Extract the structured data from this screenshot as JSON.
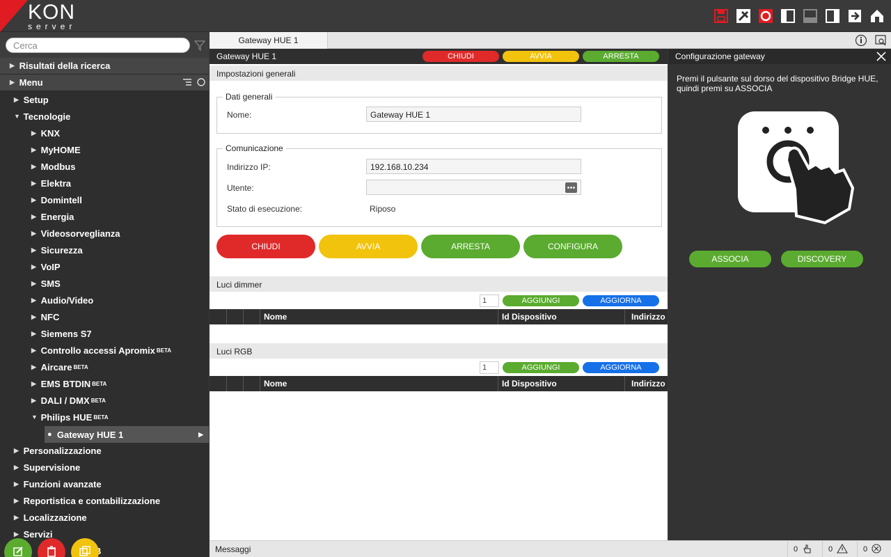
{
  "header": {
    "logo_text": "KON",
    "logo_sub": "server",
    "toolbar_icons": [
      "save-icon",
      "pin-icon",
      "sync-icon",
      "panel-left-icon",
      "panel-bottom-icon",
      "panel-right-icon",
      "exit-icon",
      "home-icon"
    ]
  },
  "sidebar": {
    "search_placeholder": "Cerca",
    "results_label": "Risultati della ricerca",
    "menu_label": "Menu",
    "items": {
      "setup": "Setup",
      "tecnologie": "Tecnologie",
      "knx": "KNX",
      "myhome": "MyHOME",
      "modbus": "Modbus",
      "elektra": "Elektra",
      "domintell": "Domintell",
      "energia": "Energia",
      "video": "Videosorveglianza",
      "sicurezza": "Sicurezza",
      "voip": "VoIP",
      "sms": "SMS",
      "audio": "Audio/Video",
      "nfc": "NFC",
      "siemens": "Siemens S7",
      "apromix": "Controllo accessi Apromix",
      "aircare": "Aircare",
      "ems": "EMS BTDIN",
      "dali": "DALI / DMX",
      "philips": "Philips HUE",
      "gateway": "Gateway HUE 1",
      "personalizzazione": "Personalizzazione",
      "supervisione": "Supervisione",
      "funzioni": "Funzioni avanzate",
      "reportistica": "Reportistica e contabilizzazione",
      "localizzazione": "Localizzazione",
      "servizi": "Servizi"
    },
    "beta_label": "BETA",
    "bottom_partial": "B"
  },
  "tabs": {
    "active": "Gateway HUE 1"
  },
  "main": {
    "title": "Gateway HUE 1",
    "top_buttons": {
      "chiudi": "CHIUDI",
      "avvia": "AVVIA",
      "arresta": "ARRESTA"
    },
    "section_general": "Impostazioni generali",
    "dati_generali": "Dati generali",
    "nome_label": "Nome:",
    "nome_value": "Gateway HUE 1",
    "comunicazione": "Comunicazione",
    "ip_label": "Indirizzo IP:",
    "ip_value": "192.168.10.234",
    "utente_label": "Utente:",
    "utente_value": "",
    "stato_label": "Stato di esecuzione:",
    "stato_value": "Riposo",
    "big_buttons": {
      "chiudi": "CHIUDI",
      "avvia": "AVVIA",
      "arresta": "ARRESTA",
      "configura": "CONFIGURA"
    },
    "dimmer": {
      "title": "Luci dimmer",
      "count": "1",
      "add": "AGGIUNGI",
      "refresh": "AGGIORNA"
    },
    "rgb": {
      "title": "Luci RGB",
      "count": "1",
      "add": "AGGIUNGI",
      "refresh": "AGGIORNA"
    },
    "columns": {
      "nome": "Nome",
      "id": "Id Dispositivo",
      "indirizzo": "Indirizzo"
    }
  },
  "right_panel": {
    "title": "Configurazione gateway",
    "instruction": "Premi il pulsante sul dorso del dispositivo Bridge HUE, quindi premi su ASSOCIA",
    "associa": "ASSOCIA",
    "discovery": "DISCOVERY"
  },
  "status": {
    "messages": "Messaggi",
    "count_touch": "0",
    "count_warn": "0",
    "count_err": "0"
  },
  "colors": {
    "red": "#e02a2a",
    "yellow": "#f2c30d",
    "green": "#5aab2f",
    "blue": "#1670e8"
  }
}
